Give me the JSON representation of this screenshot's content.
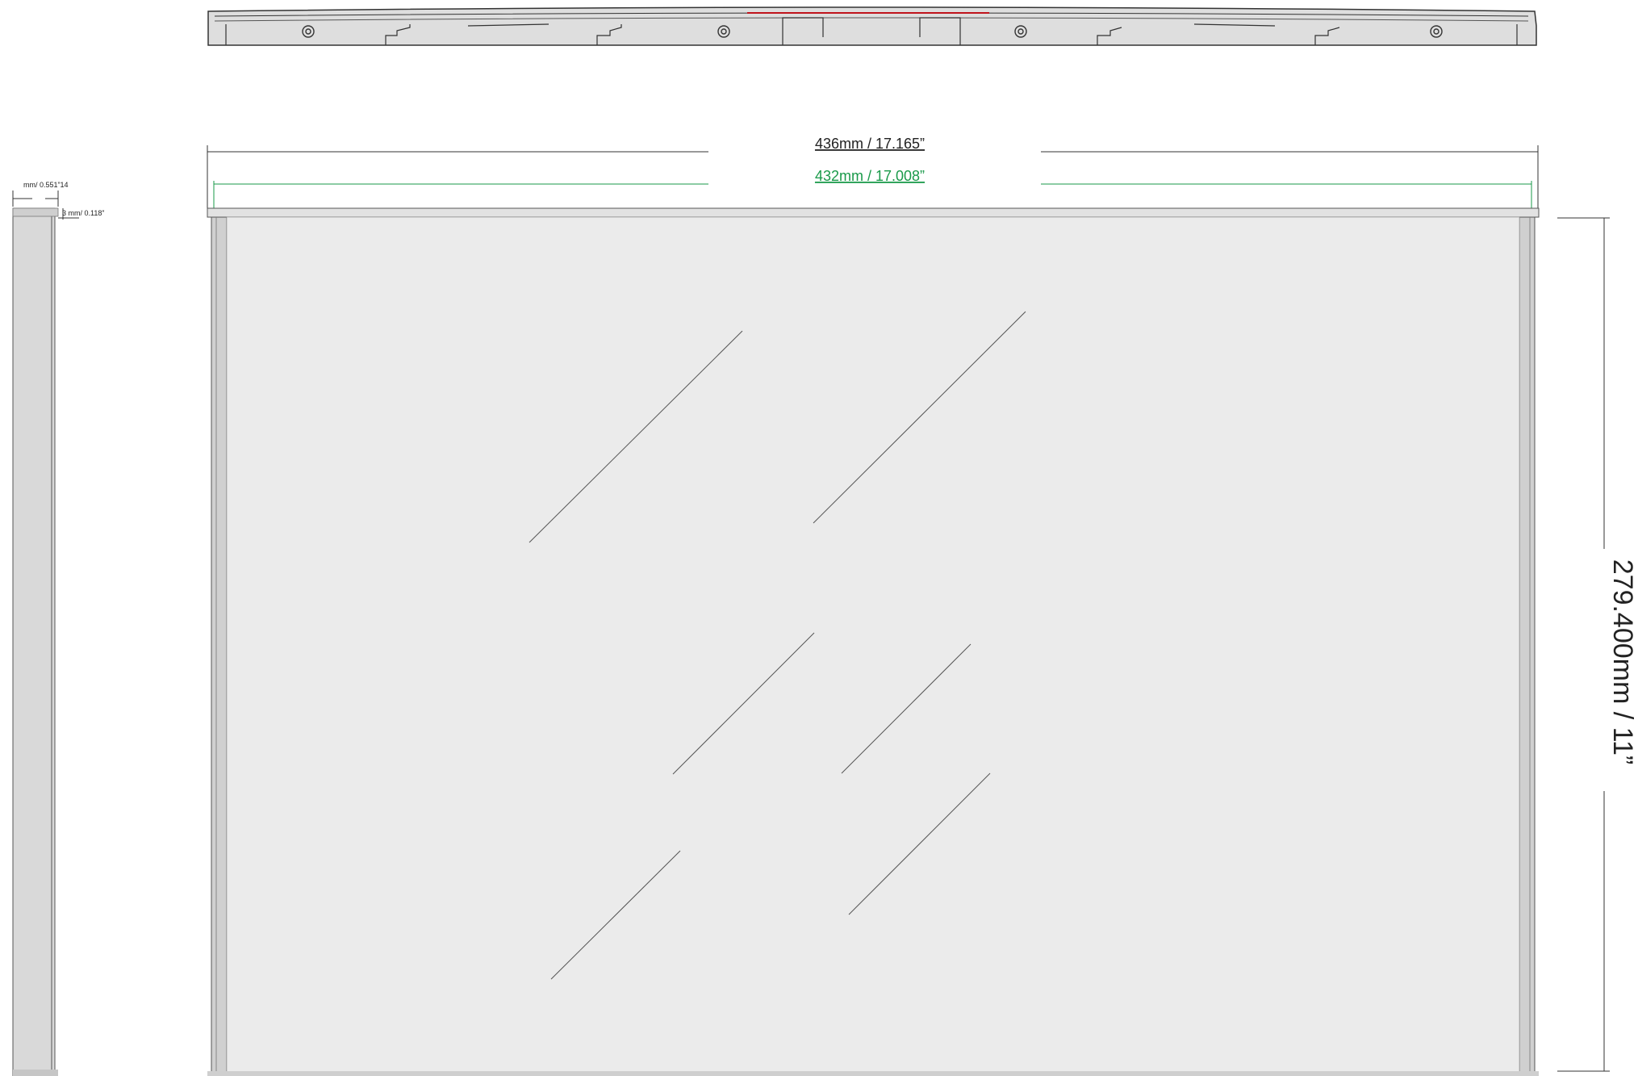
{
  "dimensions": {
    "overall_width": "436mm / 17.165”",
    "inner_width": "432mm / 17.008”",
    "height": "279.400mm / 11”",
    "depth": "mm/ 0.551”14",
    "wall_thickness": "3 mm/ 0.118”"
  },
  "colors": {
    "inner_width_line": "#1a9a4a",
    "accent_red": "#c0141c",
    "frame_fill": "#d9d9d9",
    "glass_fill": "#ebebeb",
    "outline": "#333333"
  }
}
